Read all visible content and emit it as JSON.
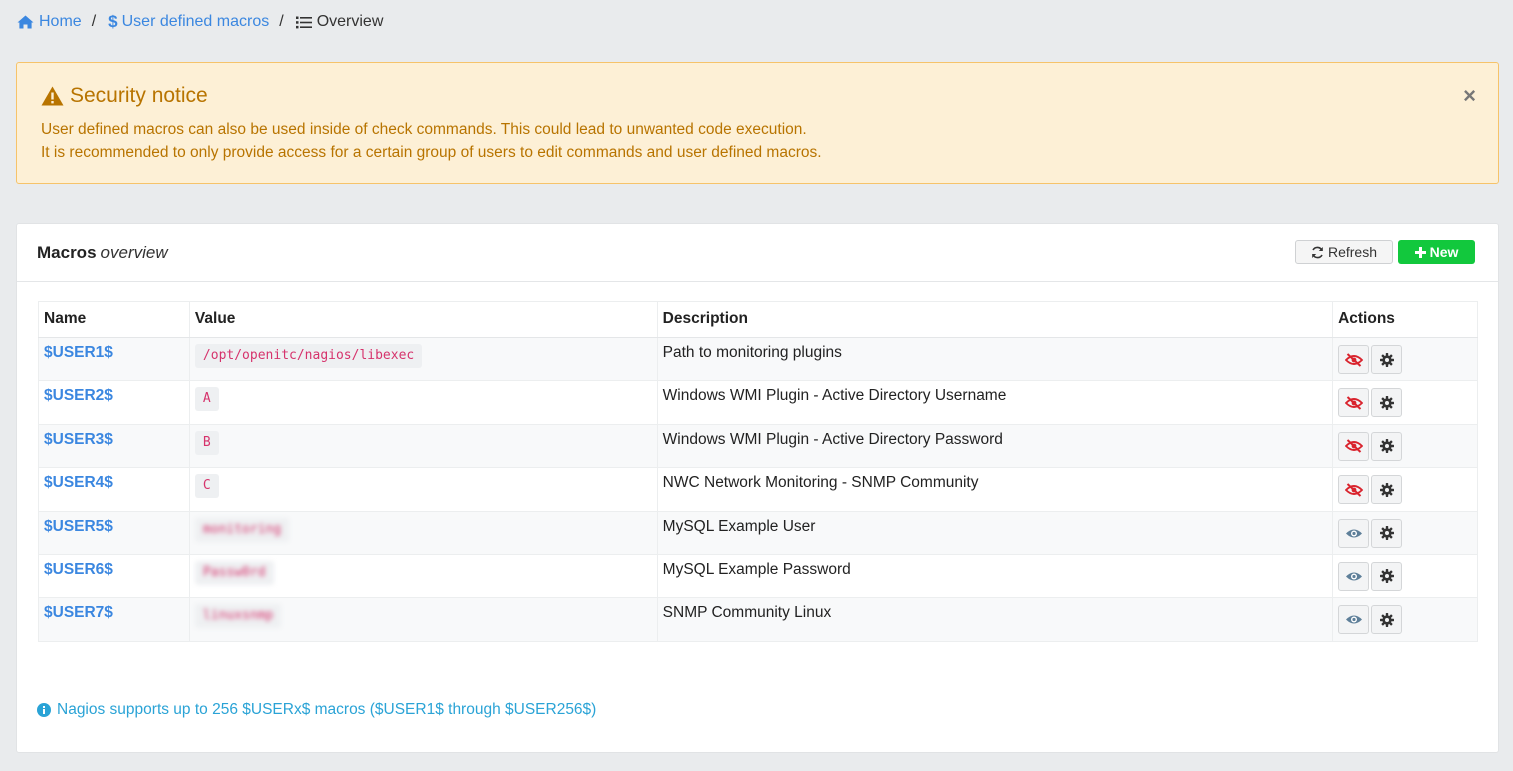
{
  "breadcrumb": {
    "home": "Home",
    "section": "User defined macros",
    "current": "Overview"
  },
  "notice": {
    "title": "Security notice",
    "line1": "User defined macros can also be used inside of check commands. This could lead to unwanted code execution.",
    "line2": "It is recommended to only provide access for a certain group of users to edit commands and user defined macros.",
    "close": "×"
  },
  "card": {
    "title_bold": "Macros",
    "title_italic": "overview",
    "refresh_label": "Refresh",
    "new_label": "New"
  },
  "table": {
    "headers": [
      "Name",
      "Value",
      "Description",
      "Actions"
    ],
    "rows": [
      {
        "name": "$USER1$",
        "value": "/opt/openitc/nagios/libexec",
        "description": "Path to monitoring plugins",
        "hidden": false
      },
      {
        "name": "$USER2$",
        "value": "A",
        "description": "Windows WMI Plugin - Active Directory Username",
        "hidden": false
      },
      {
        "name": "$USER3$",
        "value": "B",
        "description": "Windows WMI Plugin - Active Directory Password",
        "hidden": false
      },
      {
        "name": "$USER4$",
        "value": "C",
        "description": "NWC Network Monitoring - SNMP Community",
        "hidden": false
      },
      {
        "name": "$USER5$",
        "value": "monitoring",
        "description": "MySQL Example User",
        "hidden": true
      },
      {
        "name": "$USER6$",
        "value": "Passw0rd",
        "description": "MySQL Example Password",
        "hidden": true
      },
      {
        "name": "$USER7$",
        "value": "linuxsnmp",
        "description": "SNMP Community Linux",
        "hidden": true
      }
    ]
  },
  "footer_info": "Nagios supports up to 256 $USERx$ macros ($USER1$ through $USER256$)",
  "colors": {
    "link": "#3b87e0",
    "warning": "#b87400",
    "success": "#12c83d",
    "danger": "#d9232d",
    "code": "#d6336c",
    "info": "#2aa3d6"
  }
}
